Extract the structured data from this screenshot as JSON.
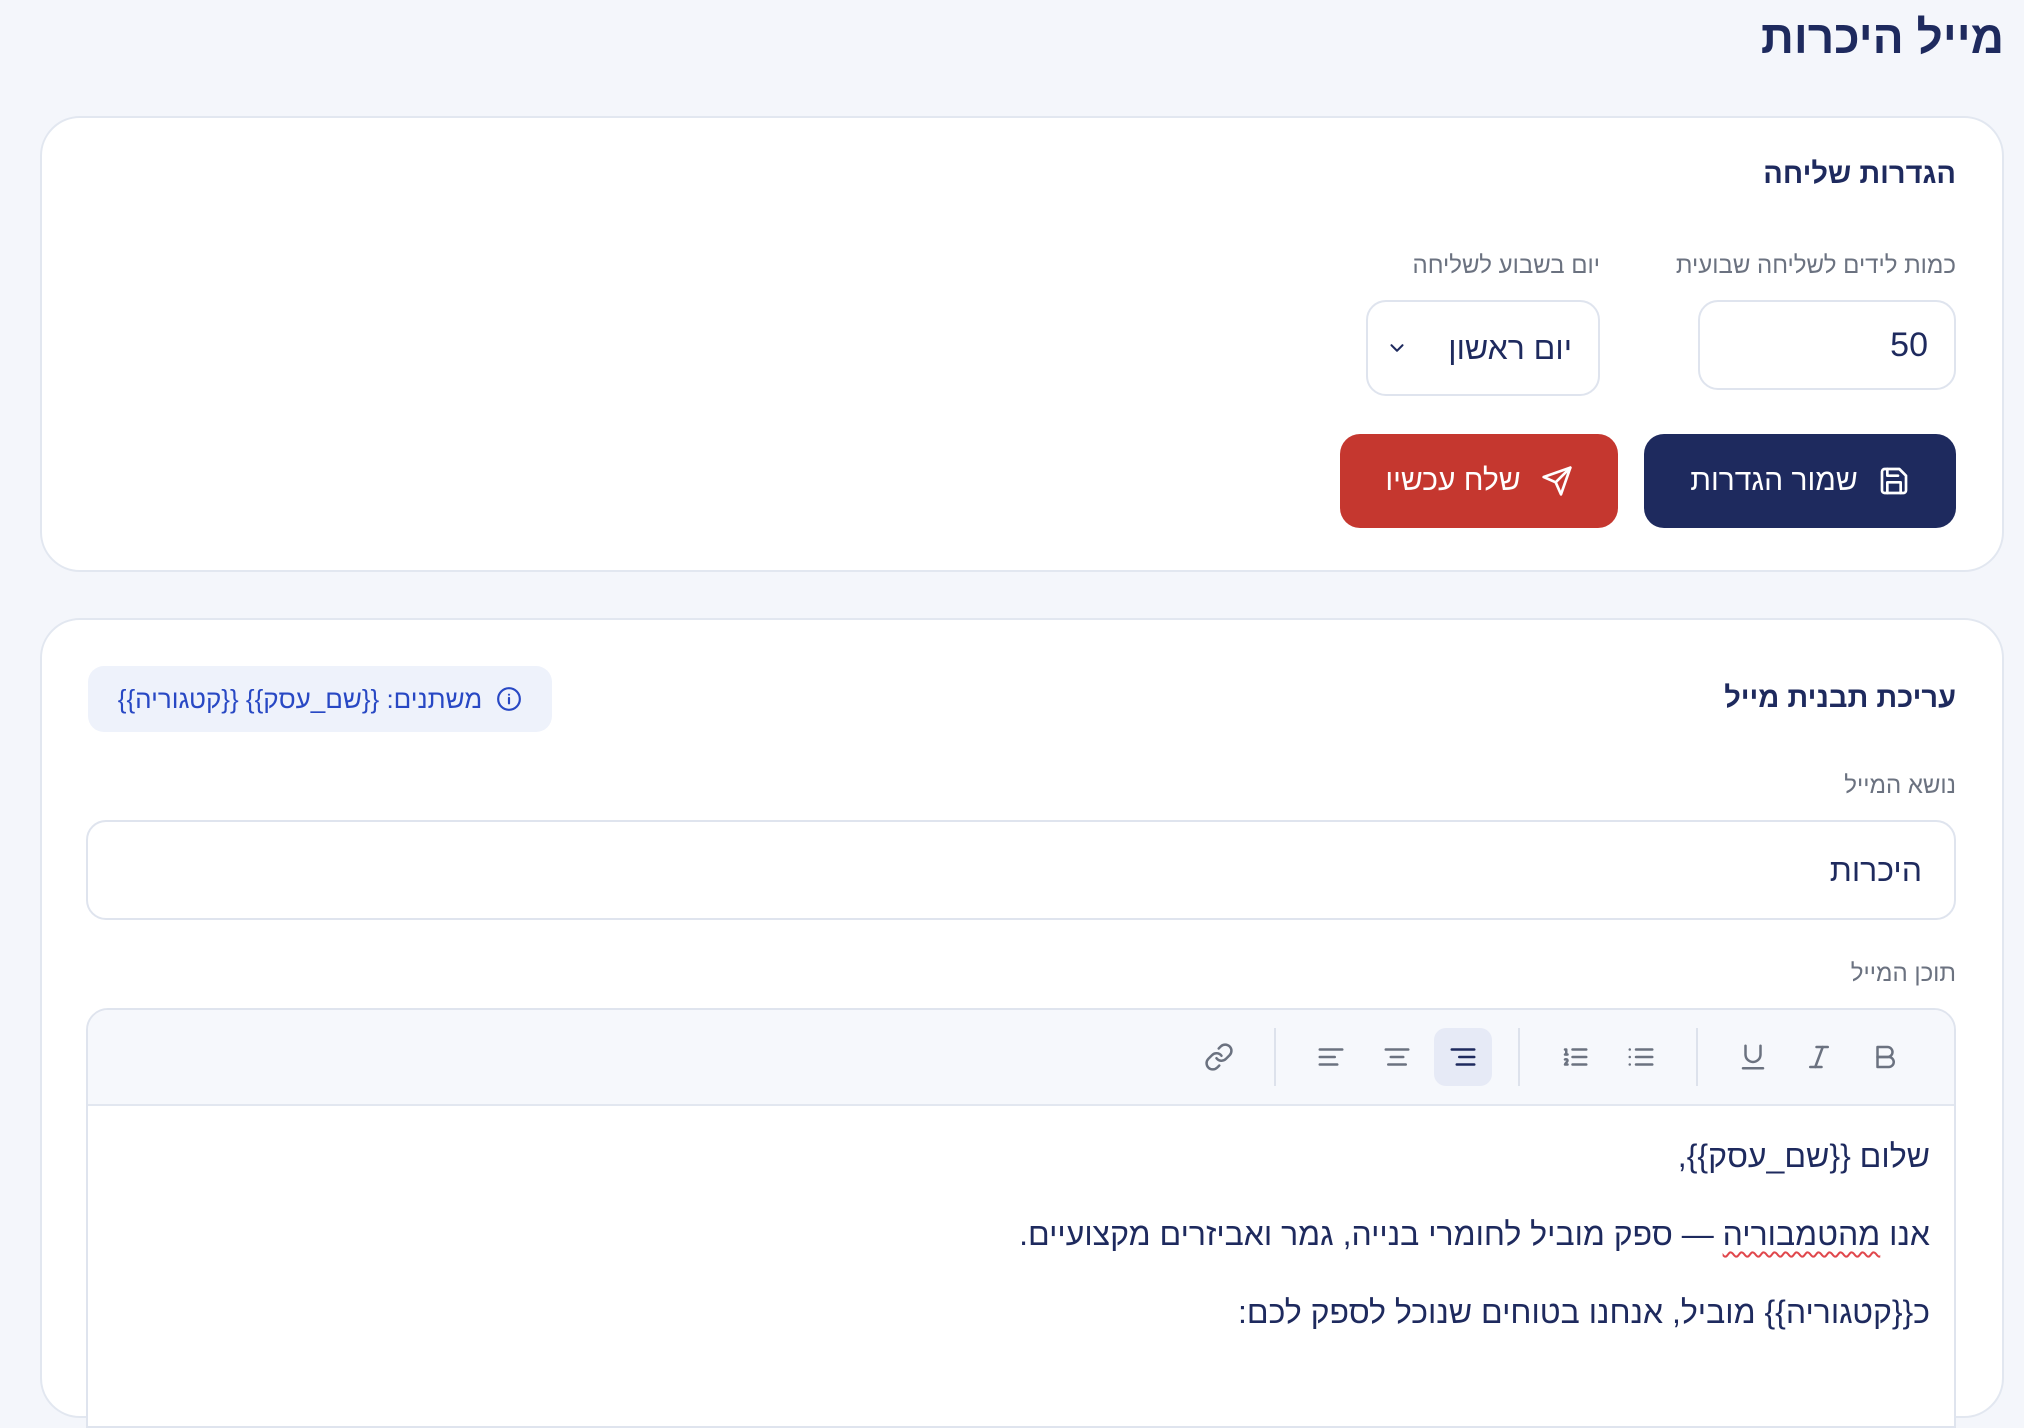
{
  "page": {
    "title": "מייל היכרות"
  },
  "settings": {
    "title": "הגדרות שליחה",
    "leads_label": "כמות לידים לשליחה שבועית",
    "leads_value": "50",
    "day_label": "יום בשבוע לשליחה",
    "day_value": "יום ראשון",
    "save_label": "שמור הגדרות",
    "send_label": "שלח עכשיו"
  },
  "template": {
    "title": "עריכת תבנית מייל",
    "vars_text": "משתנים: {{שם_עסק}} {{קטגוריה}}",
    "subject_label": "נושא המייל",
    "subject_value": "היכרות",
    "content_label": "תוכן המייל",
    "body": {
      "line1": "שלום {{שם_עסק}},",
      "line2_before": "אנו ",
      "line2_spell": "מהטמבוריה",
      "line2_after": " — ספק מוביל לחומרי בנייה, גמר ואביזרים מקצועיים.",
      "line3": "כ{{קטגוריה}} מוביל, אנחנו בטוחים שנוכל לספק לכם:"
    }
  },
  "colors": {
    "primary": "#1e2a5e",
    "danger": "#c5372f",
    "info": "#2848c4",
    "background": "#f4f6fb"
  }
}
